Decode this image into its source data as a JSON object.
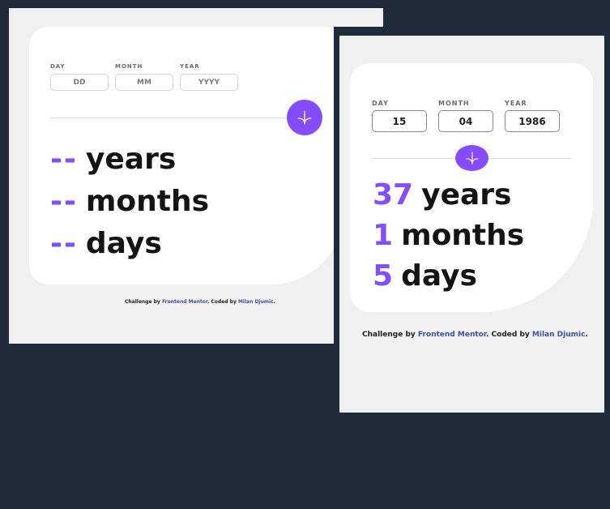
{
  "screen_empty": {
    "labels": {
      "day": "DAY",
      "month": "MONTH",
      "year": "YEAR"
    },
    "placeholders": {
      "day": "DD",
      "month": "MM",
      "year": "YYYY"
    },
    "results": {
      "years_value": "--",
      "years_label": "years",
      "months_value": "--",
      "months_label": "months",
      "days_value": "--",
      "days_label": "days"
    },
    "footer": {
      "prefix": "Challenge by ",
      "link1": "Frontend Mentor",
      "middle": ". Coded by ",
      "link2": "Milan Djumic",
      "suffix": "."
    }
  },
  "screen_filled": {
    "labels": {
      "day": "DAY",
      "month": "MONTH",
      "year": "YEAR"
    },
    "values": {
      "day": "15",
      "month": "04",
      "year": "1986"
    },
    "results": {
      "years_value": "37",
      "years_label": "years",
      "months_value": "1",
      "months_label": "months",
      "days_value": "5",
      "days_label": "days"
    },
    "footer": {
      "prefix": "Challenge by ",
      "link1": "Frontend Mentor",
      "middle": ". Coded by ",
      "link2": "Milan Djumic",
      "suffix": "."
    }
  },
  "icons": {
    "submit": "arrow-down-icon"
  },
  "colors": {
    "accent": "#854dff",
    "background": "#1f2a3a",
    "link": "#3e52a3"
  }
}
